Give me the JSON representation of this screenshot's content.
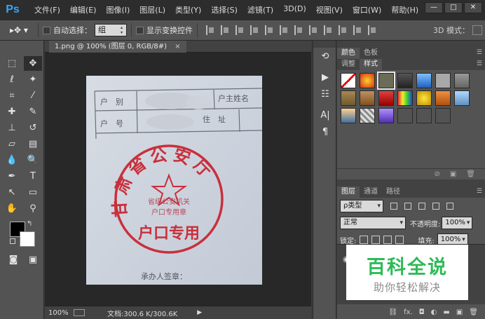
{
  "app": {
    "logo": "Ps"
  },
  "menu": [
    "文件(F)",
    "编辑(E)",
    "图像(I)",
    "图层(L)",
    "类型(Y)",
    "选择(S)",
    "滤镜(T)",
    "3D(D)",
    "视图(V)",
    "窗口(W)",
    "帮助(H)"
  ],
  "window_controls": [
    "—",
    "□",
    "✕"
  ],
  "options": {
    "tool_icon": "move-icon",
    "auto_select_label": "自动选择：",
    "auto_select_value": "组",
    "show_transform_label": "显示变换控件",
    "mode_3d_label": "3D 模式："
  },
  "document": {
    "tab_title": "1.png @ 100% (图层 0, RGB/8#)",
    "tab_close": "×",
    "image": {
      "row1_label_a": "户　别",
      "row1_label_b": "户主姓名",
      "row2_label_a": "户　号",
      "row2_label_b": "住　址",
      "seal_ring_text": "甘肃省公安厅",
      "seal_inner_line1": "省级公安机关",
      "seal_inner_line2": "户口专用章",
      "seal_big_text": "户口专用",
      "bottom_text": "承办人签章："
    }
  },
  "status": {
    "zoom": "100%",
    "doc_size": "文档:300.6 K/300.6K",
    "arrow": "▶"
  },
  "panels": {
    "top_tabs": [
      "颜色",
      "色板"
    ],
    "second_tabs": [
      "调整",
      "样式"
    ],
    "menu_icon": "☰",
    "layers_tabs": [
      "图层",
      "通道",
      "路径"
    ],
    "kind_filter": "ρ类型",
    "blend_mode": "正常",
    "opacity_label": "不透明度:",
    "opacity_value": "100%",
    "lock_label": "锁定:",
    "fill_label": "填充:",
    "fill_value": "100%",
    "footer_fx": "fx."
  },
  "watermark": {
    "title": "百科全说",
    "subtitle": "助你轻松解决"
  }
}
